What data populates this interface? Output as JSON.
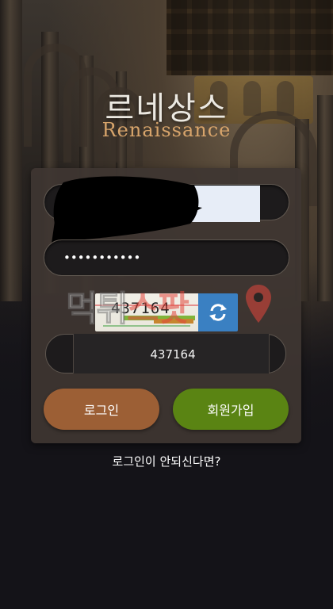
{
  "logo": {
    "korean": "르네상스",
    "english": "Renaissance"
  },
  "login_form": {
    "password_value": "•••••••••••",
    "captcha_code": "437164",
    "captcha_input_value": "437164",
    "login_button": "로그인",
    "signup_button": "회원가입"
  },
  "help_link": "로그인이 안되신다면?",
  "watermark": {
    "part1": "먹튀",
    "part2": "스팟"
  },
  "icons": {
    "refresh": "refresh-icon",
    "map_pin": "map-pin-icon"
  },
  "colors": {
    "login_button": "#9c5f35",
    "signup_button": "#5a8413",
    "logo_accent": "#d7a46b",
    "refresh_button": "#3a80c2"
  }
}
